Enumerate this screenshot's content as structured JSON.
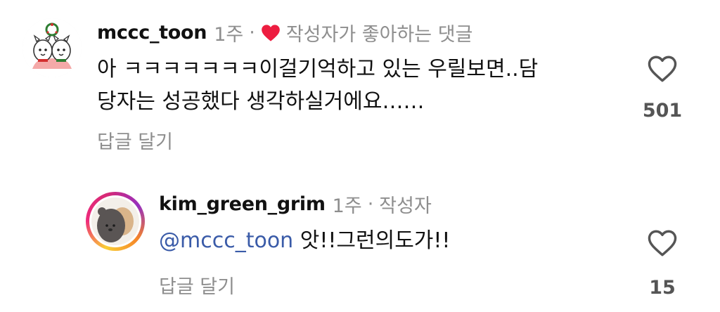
{
  "comments": [
    {
      "username": "mccc_toon",
      "time": "1주",
      "separator": "·",
      "liked_by_author_icon": "heart-filled-icon",
      "liked_by_author_text": "작성자가 좋아하는 댓글",
      "text_line1": "아 ㅋㅋㅋㅋㅋㅋㅋ이걸기억하고 있는 우릴보면..담",
      "text_line2": "당자는 성공했다 생각하실거에요……",
      "reply_label": "답글 달기",
      "like_icon": "heart-outline-icon",
      "like_count": "501"
    },
    {
      "username": "kim_green_grim",
      "time": "1주",
      "separator": "·",
      "author_badge": "작성자",
      "mention": "@mccc_toon",
      "text": " 앗!!그런의도가!!",
      "reply_label": "답글 달기",
      "like_icon": "heart-outline-icon",
      "like_count": "15"
    }
  ],
  "colors": {
    "heart_red": "#ed1d40",
    "mention_blue": "#3a5ba8",
    "muted_gray": "#8e8e8e"
  }
}
